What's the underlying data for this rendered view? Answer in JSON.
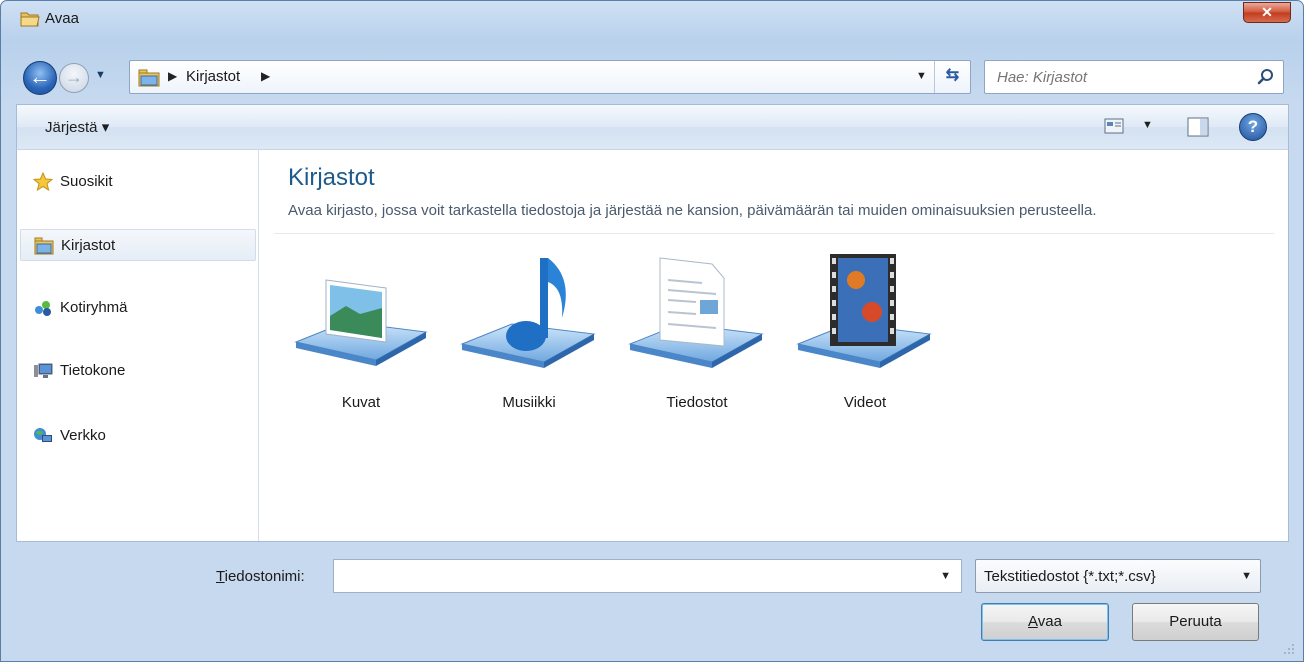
{
  "window": {
    "title": "Avaa",
    "close_label": "✕"
  },
  "address": {
    "crumbs": [
      "Kirjastot"
    ],
    "search_placeholder": "Hae: Kirjastot"
  },
  "toolbar": {
    "organize_label": "Järjestä ▾",
    "help_label": "?"
  },
  "sidebar": {
    "items": [
      {
        "label": "Suosikit",
        "icon": "star-icon",
        "selected": false
      },
      {
        "label": "Kirjastot",
        "icon": "libraries-icon",
        "selected": true
      },
      {
        "label": "Kotiryhmä",
        "icon": "homegroup-icon",
        "selected": false
      },
      {
        "label": "Tietokone",
        "icon": "computer-icon",
        "selected": false
      },
      {
        "label": "Verkko",
        "icon": "network-icon",
        "selected": false
      }
    ]
  },
  "main": {
    "title": "Kirjastot",
    "description": "Avaa kirjasto, jossa voit tarkastella tiedostoja ja järjestää ne kansion, päivämäärän tai muiden ominaisuuksien perusteella.",
    "libraries": [
      {
        "label": "Kuvat",
        "icon": "pictures-library-icon"
      },
      {
        "label": "Musiikki",
        "icon": "music-library-icon"
      },
      {
        "label": "Tiedostot",
        "icon": "documents-library-icon"
      },
      {
        "label": "Videot",
        "icon": "videos-library-icon"
      }
    ]
  },
  "footer": {
    "filename_label_underlined": "T",
    "filename_label_rest": "iedostonimi:",
    "filename_value": "",
    "filetype_value": "Tekstitiedostot {*.txt;*.csv}",
    "open_label_underlined": "A",
    "open_label_rest": "vaa",
    "cancel_label": "Peruuta"
  },
  "colors": {
    "accent": "#1e5a8c",
    "close_button": "#c33b1d",
    "selection": "#e6edf6"
  }
}
